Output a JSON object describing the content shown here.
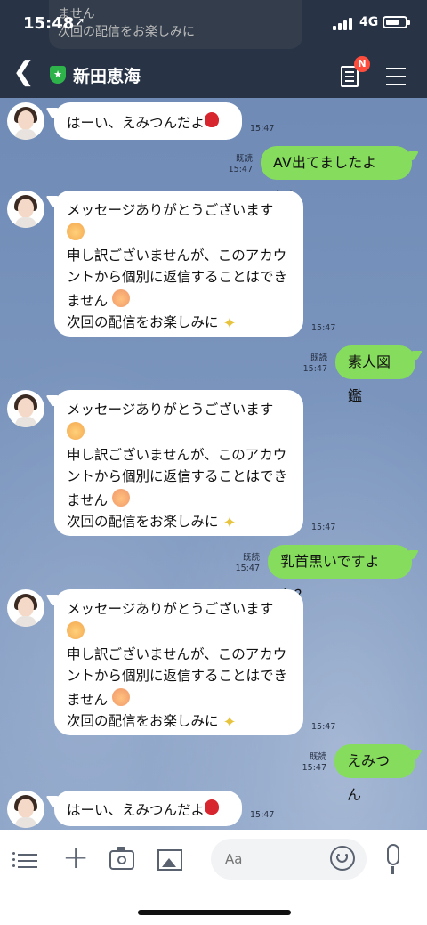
{
  "status_bar": {
    "time": "15:48",
    "network": "4G"
  },
  "ghost_notification": {
    "line1": "ません",
    "line2": "次回の配信をお楽しみに"
  },
  "header": {
    "contact_name": "新田恵海",
    "badge": "N"
  },
  "read_label": "既読",
  "messages": [
    {
      "type": "in",
      "text": "はーい、えみつんだよ",
      "time": "15:47"
    },
    {
      "type": "out",
      "text": "AV出てましたよね？",
      "time": "15:47"
    },
    {
      "type": "in",
      "line1": "メッセージありがとうございます",
      "line2": "申し訳ございませんが、このアカウ",
      "line3": "ントから個別に返信することはでき",
      "line4": "ません",
      "line5": "次回の配信をお楽しみに",
      "time": "15:47"
    },
    {
      "type": "out",
      "text": "素人図鑑",
      "time": "15:47"
    },
    {
      "type": "in",
      "line1": "メッセージありがとうございます",
      "line2": "申し訳ございませんが、このアカウ",
      "line3": "ントから個別に返信することはでき",
      "line4": "ません",
      "line5": "次回の配信をお楽しみに",
      "time": "15:47"
    },
    {
      "type": "out",
      "text": "乳首黒いですよね？",
      "time": "15:47"
    },
    {
      "type": "in",
      "line1": "メッセージありがとうございます",
      "line2": "申し訳ございませんが、このアカウ",
      "line3": "ントから個別に返信することはでき",
      "line4": "ません",
      "line5": "次回の配信をお楽しみに",
      "time": "15:47"
    },
    {
      "type": "out",
      "text": "えみつん",
      "time": "15:47"
    },
    {
      "type": "in",
      "text": "はーい、えみつんだよ",
      "time": "15:47"
    }
  ],
  "input": {
    "placeholder": "Aa"
  },
  "icons": [
    "chevron-left-icon",
    "shield-star-icon",
    "notes-icon",
    "menu-icon",
    "list-icon",
    "plus-icon",
    "camera-icon",
    "image-icon",
    "smiley-icon",
    "microphone-icon"
  ]
}
